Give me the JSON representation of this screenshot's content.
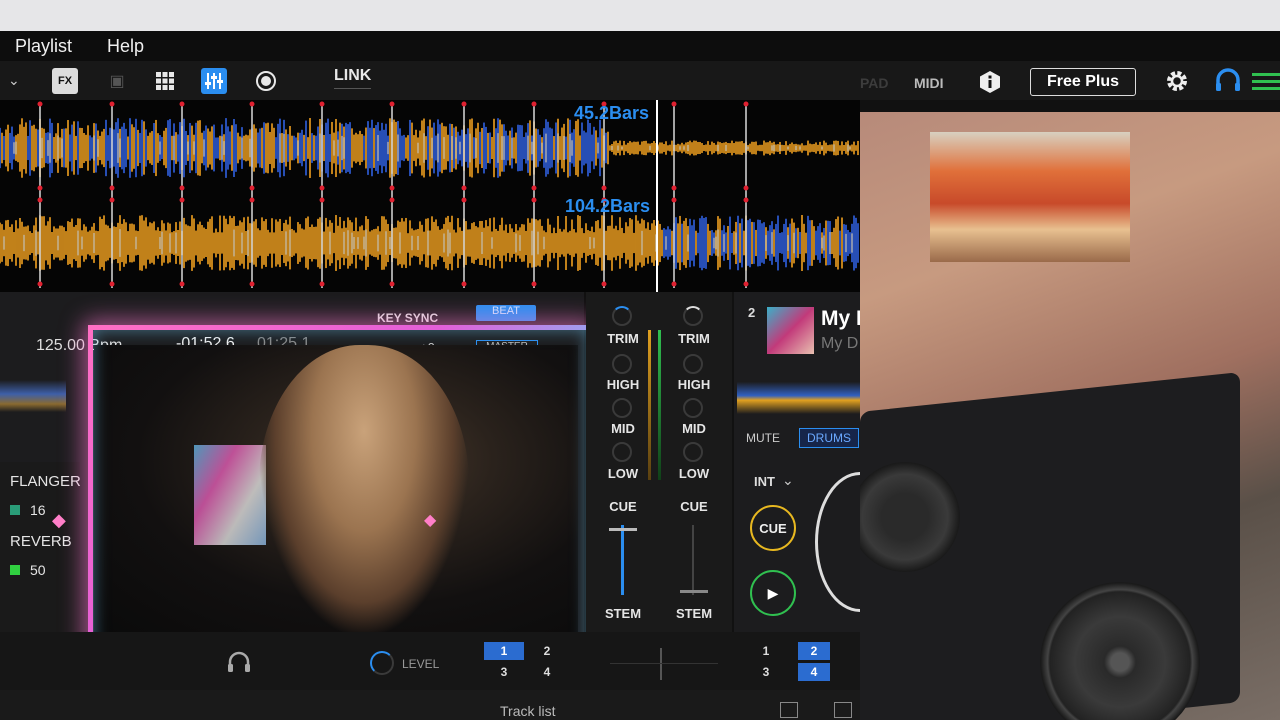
{
  "menu": {
    "playlist": "Playlist",
    "help": "Help"
  },
  "toolbar": {
    "link": "LINK",
    "pad": "PAD",
    "midi": "MIDI",
    "free_plus": "Free Plus"
  },
  "waveforms": {
    "deck1_bars": "45.2Bars",
    "deck2_bars": "104.2Bars"
  },
  "deck1": {
    "bpm": "125.00 Bpm",
    "time_remaining": "-01:52.6",
    "time_total": "01:25.1",
    "key_sync": "KEY SYNC",
    "beat": "BEAT",
    "pitch": "+0",
    "master": "MASTER",
    "fx": [
      {
        "name": "FLANGER",
        "value": "16"
      },
      {
        "name": "REVERB",
        "value": "50"
      }
    ]
  },
  "mixer": {
    "ch1": {
      "trim": "TRIM",
      "high": "HIGH",
      "mid": "MID",
      "low": "LOW",
      "cue": "CUE",
      "stem": "STEM"
    },
    "ch2": {
      "trim": "TRIM",
      "high": "HIGH",
      "mid": "MID",
      "low": "LOW",
      "cue": "CUE",
      "stem": "STEM"
    }
  },
  "deck2": {
    "number": "2",
    "track_title": "My D",
    "track_artist": "My D",
    "mute": "MUTE",
    "drums": "DRUMS",
    "int": "INT",
    "cue": "CUE"
  },
  "bottom": {
    "level": "LEVEL",
    "pads_left": [
      "1",
      "2",
      "3",
      "4"
    ],
    "pads_right": [
      "1",
      "2",
      "3",
      "4"
    ],
    "track_list": "Track list"
  },
  "colors": {
    "accent_blue": "#2b8ef0",
    "wave_orange": "#f0a020",
    "wave_blue": "#3060e0",
    "cue_yellow": "#e8b820",
    "play_green": "#30c050"
  }
}
